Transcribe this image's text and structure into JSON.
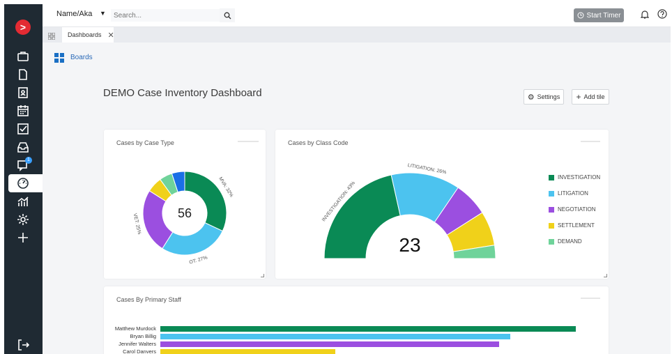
{
  "app": {
    "logo_glyph": ">",
    "accent": "#e32b33"
  },
  "sidebar": {
    "items": [
      {
        "name": "briefcase-icon"
      },
      {
        "name": "document-icon"
      },
      {
        "name": "contact-icon"
      },
      {
        "name": "calendar-icon"
      },
      {
        "name": "tasks-icon"
      },
      {
        "name": "inbox-icon"
      },
      {
        "name": "messages-icon",
        "badge": "1"
      },
      {
        "name": "dashboard-icon",
        "active": true
      },
      {
        "name": "reports-icon"
      },
      {
        "name": "settings-icon"
      },
      {
        "name": "add-icon"
      },
      {
        "name": "logout-icon"
      }
    ]
  },
  "topbar": {
    "search_scope": "Name/Aka",
    "search_placeholder": "Search...",
    "timer_label": "Start Timer"
  },
  "tabs": [
    {
      "label": "Dashboards"
    }
  ],
  "breadcrumb": {
    "label": "Boards"
  },
  "page": {
    "title": "DEMO Case Inventory Dashboard",
    "settings_label": "Settings",
    "add_tile_label": "Add tile"
  },
  "chart_data": [
    {
      "type": "pie",
      "title": "Cases by Case Type",
      "center_value": "56",
      "slices": [
        {
          "label": "MVA",
          "value": 32,
          "color": "#0a8a55"
        },
        {
          "label": "OT",
          "value": 27,
          "color": "#4cc3ef"
        },
        {
          "label": "VET",
          "value": 25,
          "color": "#9b4fe0"
        },
        {
          "label": "",
          "value": 6,
          "color": "#f0d11a"
        },
        {
          "label": "",
          "value": 5,
          "color": "#6fd39a"
        },
        {
          "label": "",
          "value": 5,
          "color": "#1a6fe6"
        }
      ],
      "data_labels": [
        "MVA: 32%",
        "OT: 27%",
        "VET: 25%"
      ]
    },
    {
      "type": "pie",
      "title": "Cases by Class Code",
      "center_value": "23",
      "slices": [
        {
          "label": "INVESTIGATION",
          "value": 43,
          "color": "#0a8a55"
        },
        {
          "label": "LITIGATION",
          "value": 26,
          "color": "#4cc3ef"
        },
        {
          "label": "NEGOTIATION",
          "value": 13,
          "color": "#9b4fe0"
        },
        {
          "label": "SETTLEMENT",
          "value": 13,
          "color": "#f0d11a"
        },
        {
          "label": "DEMAND",
          "value": 5,
          "color": "#6fd39a"
        }
      ],
      "data_labels": [
        "INVESTIGATION: 43%",
        "LITIGATION: 26%"
      ],
      "legend_position": "right"
    },
    {
      "type": "bar",
      "title": "Cases By Primary Staff",
      "orientation": "horizontal",
      "categories": [
        "Matthew Murdock",
        "Bryan Billig",
        "Jennifer Walters",
        "Carol Danvers"
      ],
      "values": [
        19,
        16,
        15.5,
        8
      ],
      "colors": [
        "#0a8a55",
        "#4cc3ef",
        "#9b4fe0",
        "#f0d11a"
      ],
      "xlim": [
        0,
        20
      ]
    }
  ]
}
